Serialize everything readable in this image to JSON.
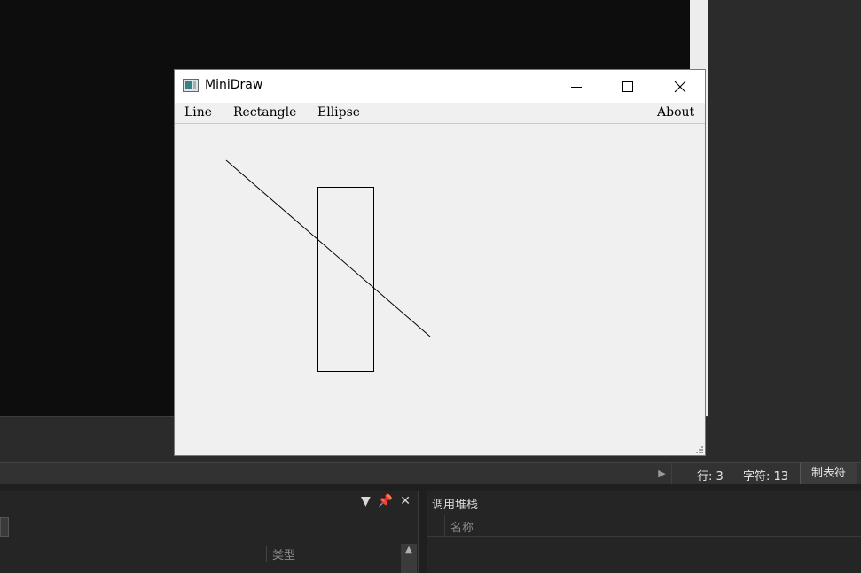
{
  "window": {
    "title": "MiniDraw",
    "app_icon": "app-window-icon",
    "controls": {
      "minimize": "minimize-icon",
      "maximize": "maximize-icon",
      "close": "close-icon"
    }
  },
  "menu": {
    "items": [
      "Line",
      "Rectangle",
      "Ellipse"
    ],
    "about": "About"
  },
  "ide": {
    "status": {
      "line": "行: 3",
      "column": "字符: 13",
      "tabs": "制表符"
    },
    "left_panel": {
      "column_type": "类型"
    },
    "right_panel": {
      "title": "调用堆栈",
      "column_name": "名称"
    }
  }
}
